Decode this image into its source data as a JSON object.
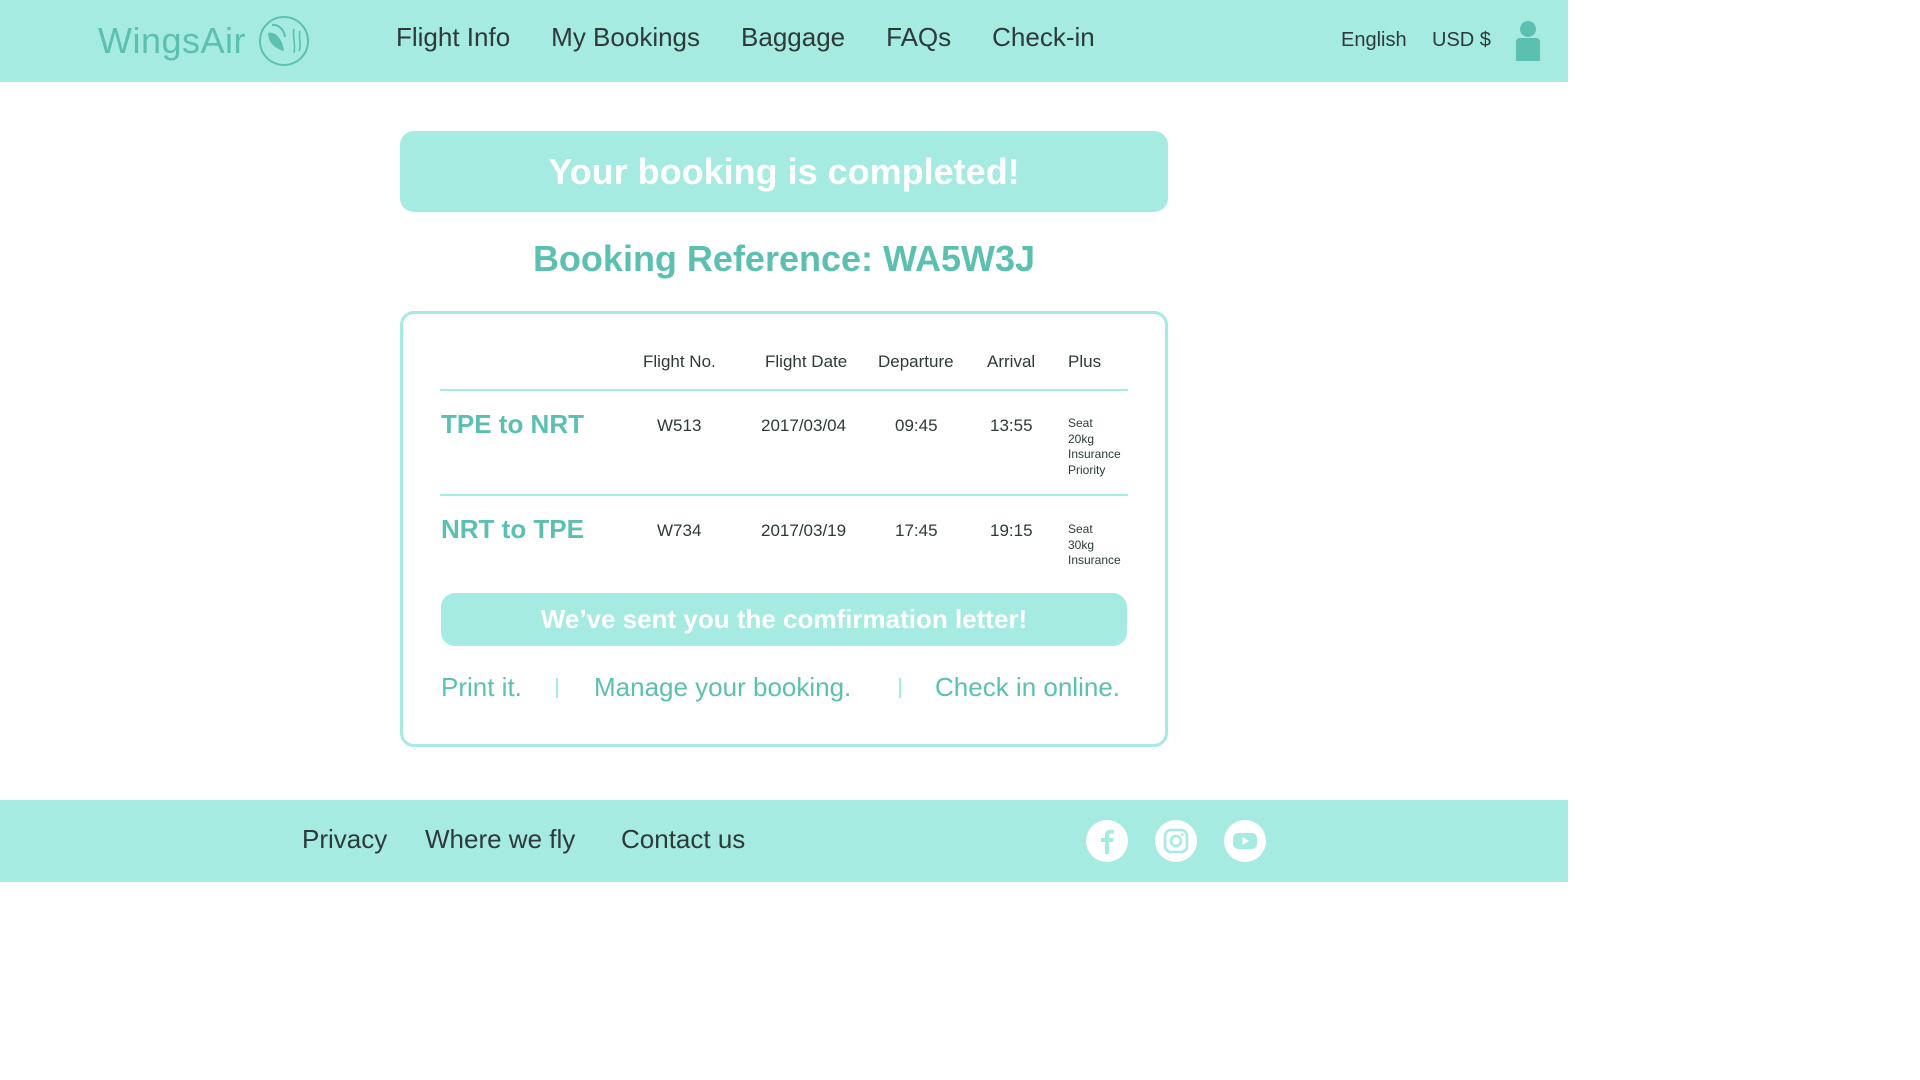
{
  "brand": {
    "name": "WingsAir",
    "accent": "#5cc0b1",
    "bar": "#a6ebe1"
  },
  "nav": {
    "items": [
      "Flight Info",
      "My Bookings",
      "Baggage",
      "FAQs",
      "Check-in"
    ]
  },
  "header": {
    "language": "English",
    "currency": "USD $"
  },
  "banner": {
    "text": "Your booking is completed!"
  },
  "booking": {
    "reference_label": "Booking Reference: WA5W3J"
  },
  "table": {
    "headers": [
      "Flight No.",
      "Flight Date",
      "Departure",
      "Arrival",
      "Plus"
    ],
    "rows": [
      {
        "route": "TPE to NRT",
        "flight_no": "W513",
        "date": "2017/03/04",
        "departure": "09:45",
        "arrival": "13:55",
        "plus": [
          "Seat",
          "20kg",
          "Insurance",
          "Priority"
        ]
      },
      {
        "route": "NRT to TPE",
        "flight_no": "W734",
        "date": "2017/03/19",
        "departure": "17:45",
        "arrival": "19:15",
        "plus": [
          "Seat",
          "30kg",
          "Insurance"
        ]
      }
    ]
  },
  "confirmation": {
    "text": "We’ve sent you the comfirmation letter!"
  },
  "actions": {
    "print": "Print it.",
    "manage": "Manage your booking.",
    "checkin": "Check in online."
  },
  "footer": {
    "links": [
      "Privacy",
      "Where we fly",
      "Contact us"
    ],
    "social": [
      "facebook-icon",
      "instagram-icon",
      "youtube-icon"
    ]
  }
}
